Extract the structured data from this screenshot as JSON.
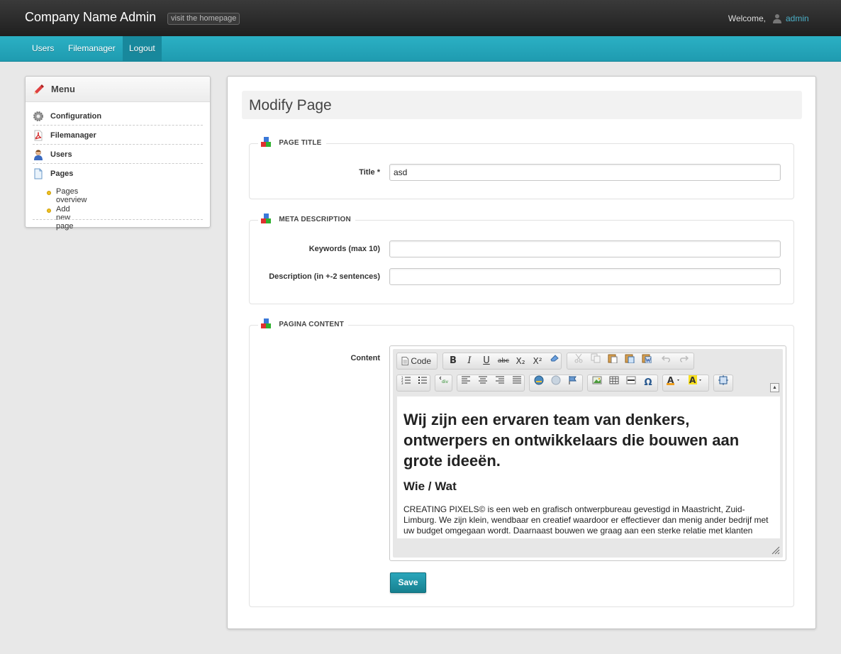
{
  "header": {
    "app_title": "Company Name Admin",
    "visit_link": "visit the homepage",
    "welcome_text": "Welcome,",
    "user_name": "admin"
  },
  "nav": {
    "items": [
      {
        "label": "Users"
      },
      {
        "label": "Filemanager"
      },
      {
        "label": "Logout"
      }
    ],
    "active": "Logout"
  },
  "sidebar": {
    "title": "Menu",
    "items": [
      {
        "label": "Configuration",
        "icon": "gear-icon"
      },
      {
        "label": "Filemanager",
        "icon": "pdf-icon"
      },
      {
        "label": "Users",
        "icon": "user-icon"
      },
      {
        "label": "Pages",
        "icon": "page-icon"
      }
    ],
    "sub_items": [
      {
        "label": "Pages overview"
      },
      {
        "label": "Add new page"
      }
    ]
  },
  "main": {
    "page_title": "Modify Page",
    "sections": {
      "page_title": {
        "legend": "PAGE TITLE",
        "title_label": "Title *",
        "title_value": "asd"
      },
      "meta": {
        "legend": "META DESCRIPTION",
        "keywords_label": "Keywords (max 10)",
        "keywords_value": "",
        "description_label": "Description (in +-2 sentences)",
        "description_value": ""
      },
      "content": {
        "legend": "PAGINA CONTENT",
        "content_label": "Content",
        "toolbar": {
          "code_label": "Code",
          "bold": "B",
          "italic": "I",
          "underline": "U",
          "strike": "abc",
          "subscript": "X₂",
          "superscript": "X²",
          "omega": "Ω"
        },
        "heading1": "Wij zijn een ervaren team van denkers, ontwerpers en ontwikkelaars die bouwen aan grote ideeën.",
        "heading2": "Wie / Wat",
        "paragraph": "CREATING PIXELS© is een web en grafisch ontwerpbureau gevestigd in Maastricht, Zuid-Limburg. We zijn klein, wendbaar en creatief waardoor er effectiever dan menig ander bedrijf met uw budget omgegaan wordt. Daarnaast bouwen we graag aan een sterke relatie met klanten"
      }
    },
    "save_label": "Save"
  },
  "colors": {
    "accent": "#1f9bb0",
    "link": "#4bb0c8",
    "topbar": "#2a2a2a"
  }
}
